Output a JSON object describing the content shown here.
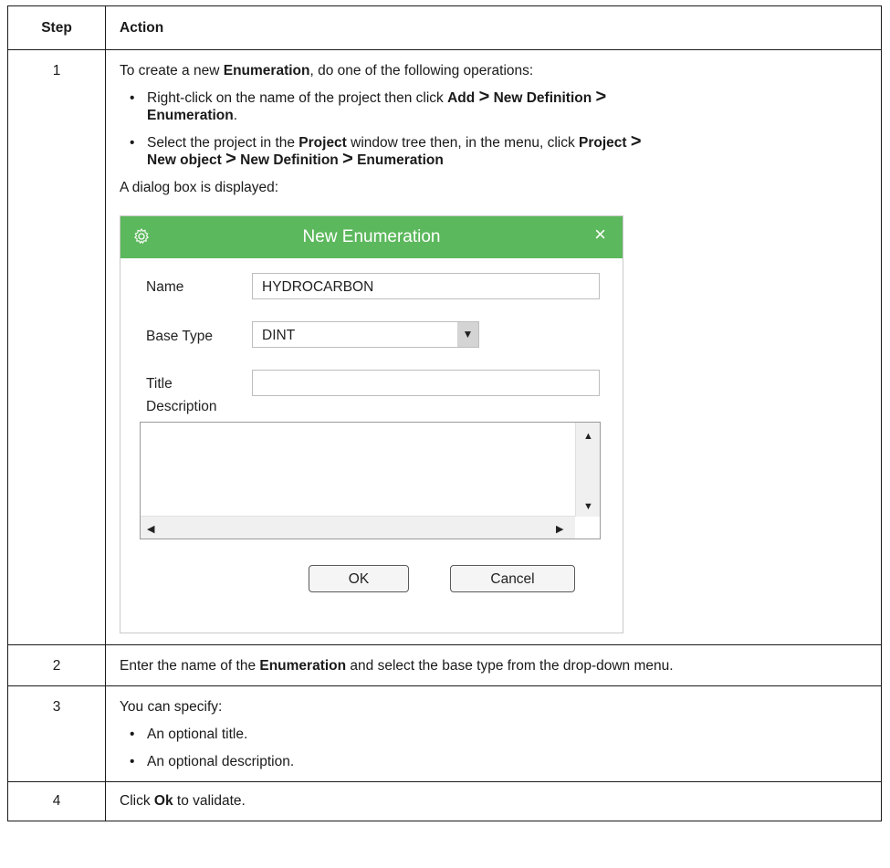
{
  "table": {
    "header_step": "Step",
    "header_action": "Action"
  },
  "row1": {
    "step": "1",
    "intro_pre": "To create a new ",
    "intro_bold": "Enumeration",
    "intro_post": ", do one of the following operations:",
    "bullet1": {
      "pre": "Right-click on the name of the project then click ",
      "add": "Add",
      "gt": ">",
      "new_def": "New Definition",
      "enum": "Enumeration",
      "end": "."
    },
    "bullet2": {
      "pre": "Select the project in the ",
      "project": "Project",
      "mid": " window tree then, in the menu, click ",
      "project2": "Project",
      "gt": ">",
      "new_object": "New object",
      "new_def": "New Definition",
      "enum": "Enumeration"
    },
    "dialog_note": "A dialog box is displayed:"
  },
  "dialog": {
    "title": "New Enumeration",
    "close_glyph": "×",
    "name_label": "Name",
    "name_value": "HYDROCARBON",
    "base_type_label": "Base Type",
    "base_type_value": "DINT",
    "title_label": "Title",
    "title_value": "",
    "description_label": "Description",
    "ok_label": "OK",
    "cancel_label": "Cancel",
    "icon": "gear-icon",
    "title_bar_color": "#5cb85c"
  },
  "row2": {
    "step": "2",
    "pre": "Enter the name of the ",
    "bold": "Enumeration",
    "post": " and select the base type from the drop-down menu."
  },
  "row3": {
    "step": "3",
    "intro": "You can specify:",
    "bullet1": "An optional title.",
    "bullet2": "An optional description."
  },
  "row4": {
    "step": "4",
    "pre": "Click ",
    "bold": "Ok",
    "post": " to validate."
  }
}
